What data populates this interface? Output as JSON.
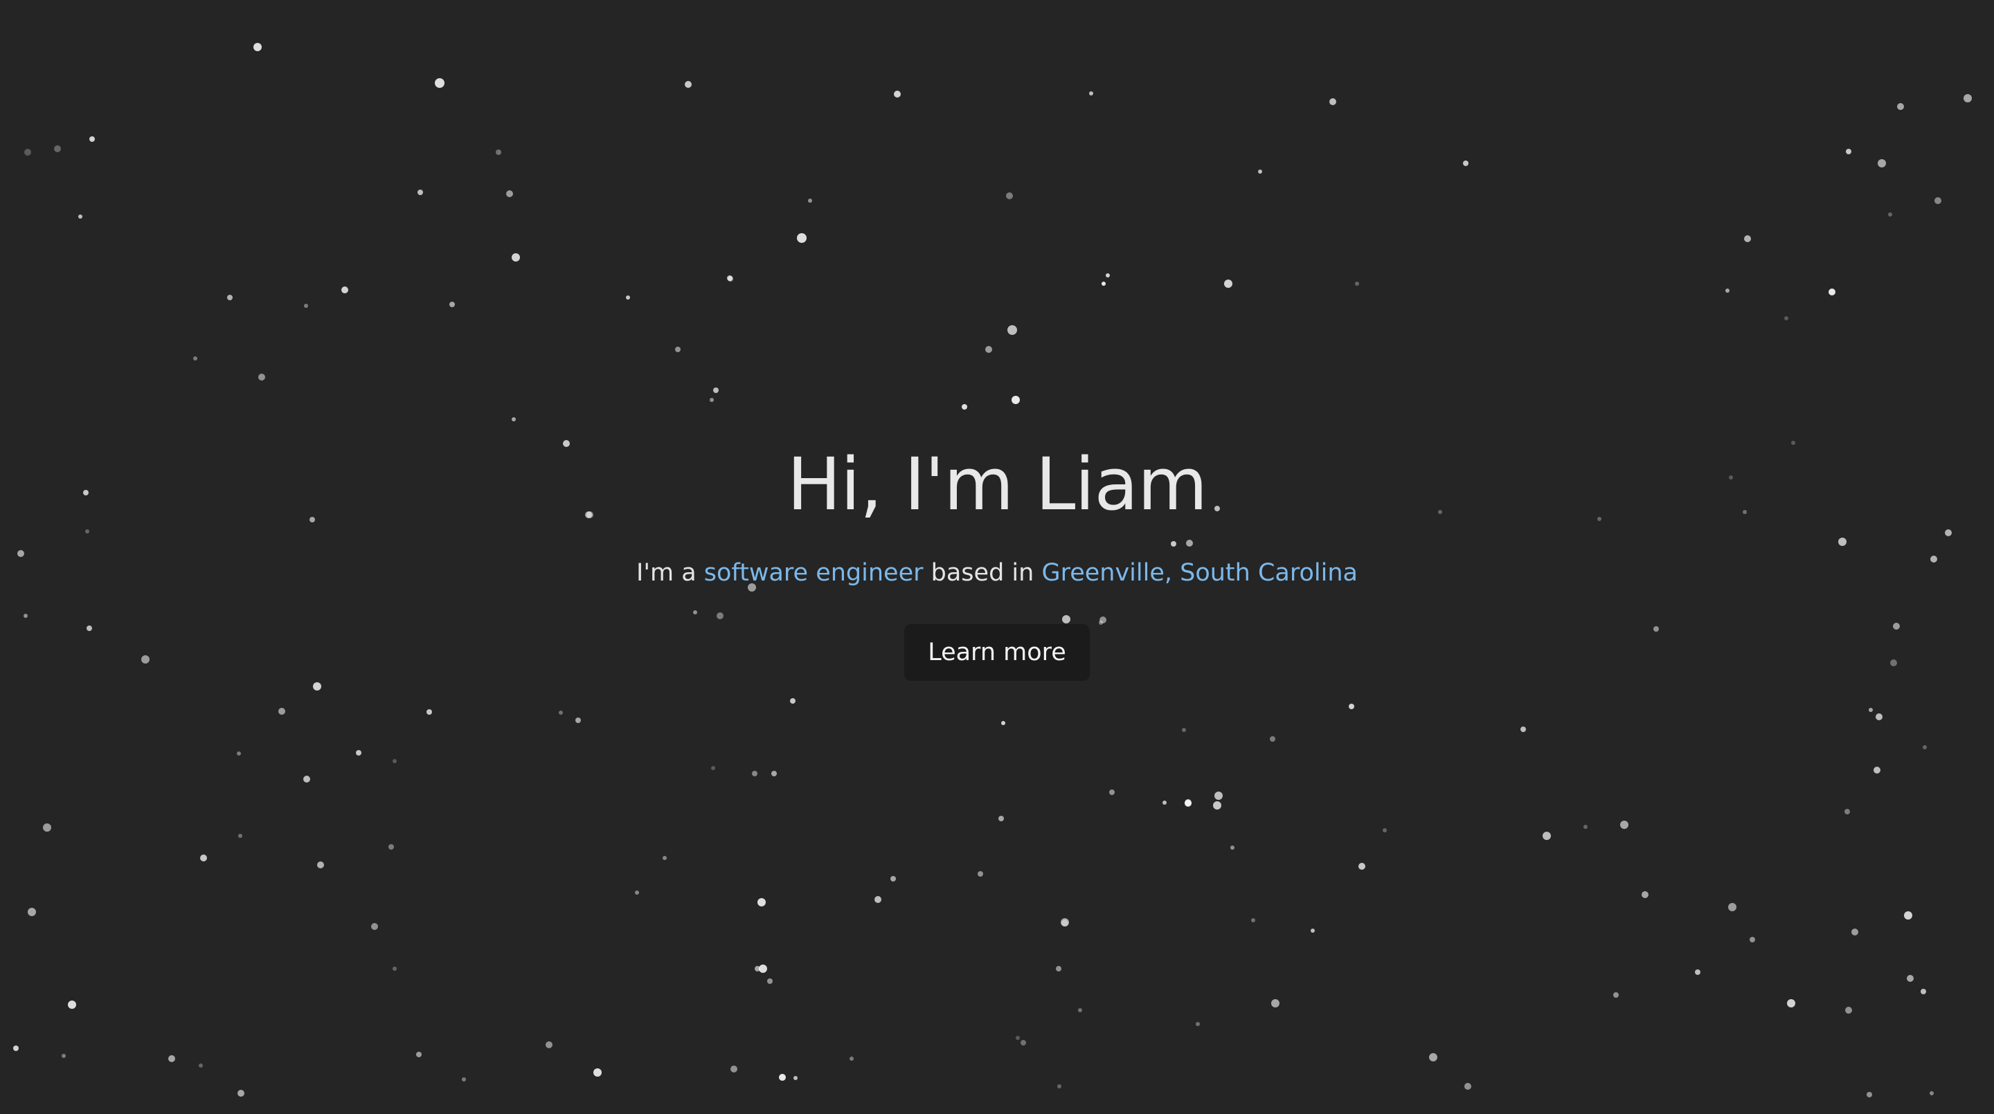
{
  "hero": {
    "title": "Hi, I'm Liam",
    "subtitle_prefix": "I'm a ",
    "role_link": "software engineer",
    "subtitle_middle": " based in ",
    "location_link": "Greenville, South Carolina",
    "cta_label": "Learn more"
  },
  "colors": {
    "background": "#252525",
    "link": "#7cb8ea",
    "text": "#e8e8e8",
    "button_bg": "#1b1b1b"
  },
  "background": {
    "type": "starfield"
  }
}
